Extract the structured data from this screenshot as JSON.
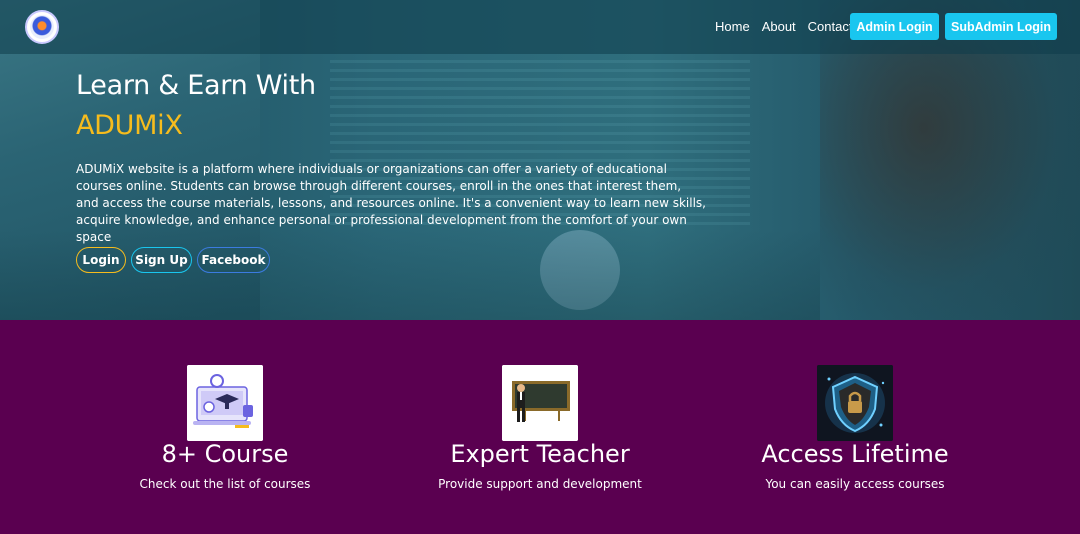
{
  "nav": {
    "links": [
      "Home",
      "About",
      "Contact"
    ],
    "admin_login": "Admin Login",
    "subadmin_login": "SubAdmin Login"
  },
  "hero": {
    "title_line1": "Learn & Earn With",
    "title_line2": "ADUMiX",
    "description": "ADUMiX website is a platform where individuals or organizations can offer a variety of educational courses online. Students can browse through different courses, enroll in the ones that interest them, and access the course materials, lessons, and resources online. It's a convenient way to learn new skills, acquire knowledge, and enhance personal or professional development from the comfort of your own space",
    "buttons": [
      "Login",
      "Sign Up",
      "Facebook"
    ]
  },
  "features": [
    {
      "icon": "online-course-icon",
      "title": "8+ Course",
      "subtitle": "Check out the list of courses"
    },
    {
      "icon": "teacher-blackboard-icon",
      "title": "Expert Teacher",
      "subtitle": "Provide support and development"
    },
    {
      "icon": "security-shield-icon",
      "title": "Access Lifetime",
      "subtitle": "You can easily access courses"
    }
  ],
  "colors": {
    "accent": "#19c6ef",
    "brand_yellow": "#f6bc1d",
    "section_bg": "#5a0050"
  }
}
